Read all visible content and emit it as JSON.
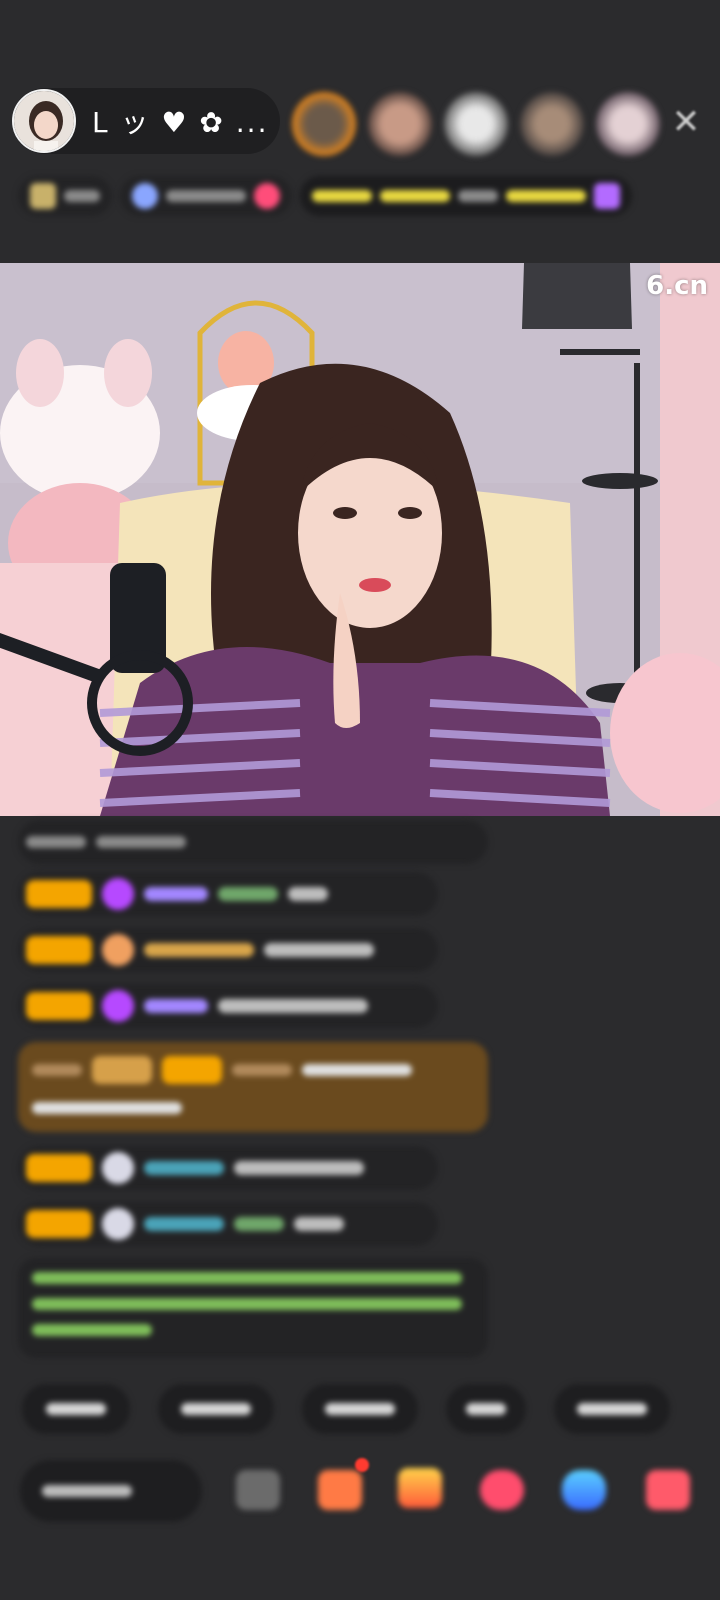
{
  "host": {
    "name": "L ッ ♥ ✿ ..."
  },
  "video": {
    "watermark": "6.cn"
  },
  "colors": {
    "background": "#2b2b2d",
    "badge": "#f4a500",
    "close": "#cfcfcf"
  },
  "icons": [
    "close-icon",
    "gift-icon",
    "lucky-bag-icon",
    "heart-icon",
    "game-icon",
    "more-icon",
    "chat-icon"
  ]
}
